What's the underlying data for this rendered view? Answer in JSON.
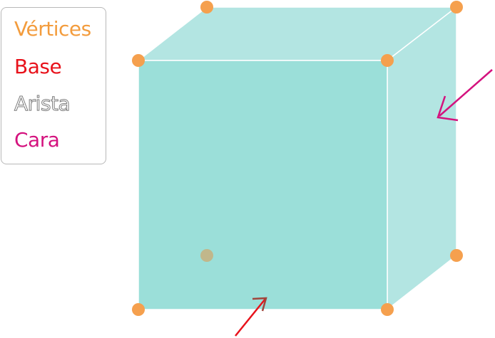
{
  "legend": {
    "items": [
      {
        "label": "Vértices",
        "color": "#F39C3D",
        "style": "filled"
      },
      {
        "label": "Base",
        "color": "#E8121B",
        "style": "filled"
      },
      {
        "label": "Arista",
        "color": "#7A7A7A",
        "style": "outlined"
      },
      {
        "label": "Cara",
        "color": "#D4127E",
        "style": "filled"
      }
    ]
  },
  "colors": {
    "front_face": "#9BDFD9",
    "side_face": "#B3E5E2",
    "top_face": "#B3E5E2",
    "edge": "#ffffff",
    "vertex": "#F5A04E",
    "hidden_vertex": "#C8B07C",
    "base_arrow": "#E8121B",
    "base_arrow_tip": "#A0463C",
    "face_arrow": "#D4127E"
  }
}
